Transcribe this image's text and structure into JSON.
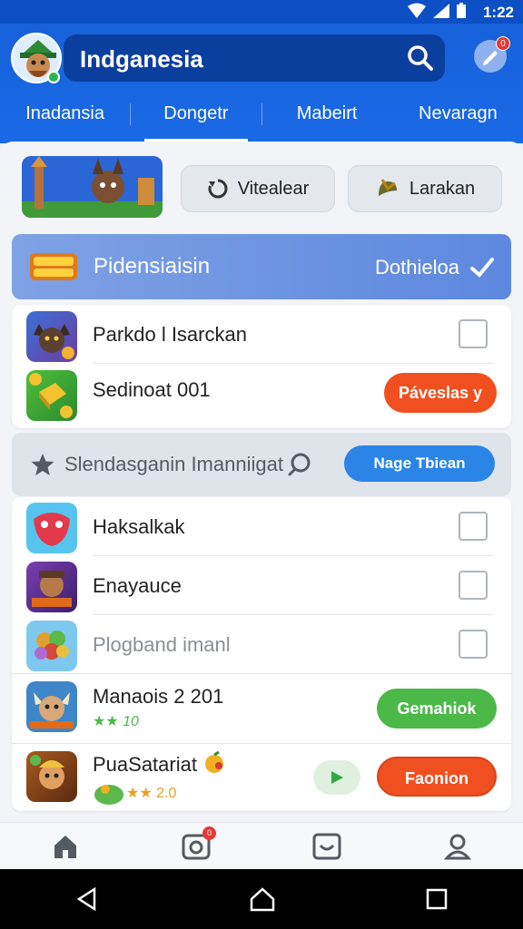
{
  "status_bar": {
    "time": "1:22"
  },
  "header": {
    "search_label": "Indganesia",
    "notification_badge": "0",
    "tabs": [
      {
        "label": "Inadansia"
      },
      {
        "label": "Dongetr"
      },
      {
        "label": "Mabeirt"
      },
      {
        "label": "Nevaragn"
      }
    ]
  },
  "promo": {
    "button1_label": "Vitealear",
    "button2_label": "Larakan"
  },
  "section1": {
    "title": "Pidensiaisin",
    "action_label": "Dothieloa",
    "items": [
      {
        "title": "Parkdo l Isarckan"
      },
      {
        "title": "Sedinoat 001",
        "button_label": "Páveslas y"
      }
    ]
  },
  "section2": {
    "title": "Slendasganin Imanniigat",
    "button_label": "Nage Tbiean",
    "items": [
      {
        "title": "Haksalkak"
      },
      {
        "title": "Enayauce"
      },
      {
        "title": "Plogband imanl"
      },
      {
        "title": "Manaois 2 201",
        "rating": "★★ 10",
        "button_label": "Gemahiok"
      },
      {
        "title": "PuaSatariat",
        "rating": "★★ 2.0",
        "button_label": "Faonion"
      }
    ]
  },
  "colors": {
    "primary": "#1761da",
    "orange": "#f0501f",
    "green": "#4cb848",
    "blue_button": "#2a85e6"
  }
}
